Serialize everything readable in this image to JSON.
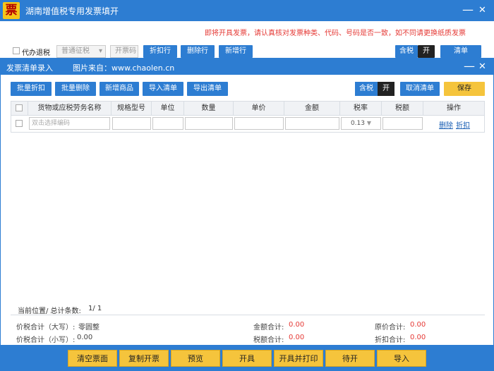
{
  "window": {
    "logo_char": "票",
    "title": "湖南增值税专用发票填开",
    "minimize": "—",
    "close": "✕"
  },
  "notice": "即将开具发票，请认真核对发票种类、代码、号码是否一致，如不同请更换纸质发票",
  "outer_toolbar": {
    "agent_label": "代办退税",
    "invoice_type": "普通征税",
    "open_code": "开票码",
    "buttons": [
      "折扣行",
      "删除行",
      "新增行"
    ],
    "tax_toggle": {
      "label": "含税",
      "state": "开"
    },
    "list_btn": "清单"
  },
  "dialog": {
    "title": "发票清单录入",
    "source": "图片来自：www.chaolen.cn",
    "minimize": "—",
    "close": "✕",
    "left_buttons": [
      "批量折扣",
      "批量删除",
      "新增商品",
      "导入清单",
      "导出清单"
    ],
    "tax_toggle": {
      "label": "含税",
      "state": "开"
    },
    "cancel_btn": "取消清单",
    "save_btn": "保存"
  },
  "table": {
    "headers": [
      "货物或应税劳务名称",
      "规格型号",
      "单位",
      "数量",
      "单价",
      "金额",
      "税率",
      "税额",
      "操作"
    ],
    "rows": [
      {
        "name_placeholder": "双击选择编码",
        "tax_rate": "0.13",
        "actions": [
          "删除",
          "折扣"
        ]
      }
    ]
  },
  "status": {
    "location_label": "当前位置/ 总计条数:",
    "location_value": "1/ 1"
  },
  "summary": {
    "total_upper_label": "价税合计（大写）:",
    "total_upper_value": "零圆整",
    "total_lower_label": "价税合计（小写）:",
    "total_lower_value": "0.00",
    "amount_label": "金额合计:",
    "amount_value": "0.00",
    "tax_label": "税额合计:",
    "tax_value": "0.00",
    "orig_label": "原价合计:",
    "orig_value": "0.00",
    "discount_label": "折扣合计:",
    "discount_value": "0.00"
  },
  "actions": [
    "清空票面",
    "复制开票",
    "预览",
    "开具",
    "开具并打印",
    "待开",
    "导入"
  ]
}
